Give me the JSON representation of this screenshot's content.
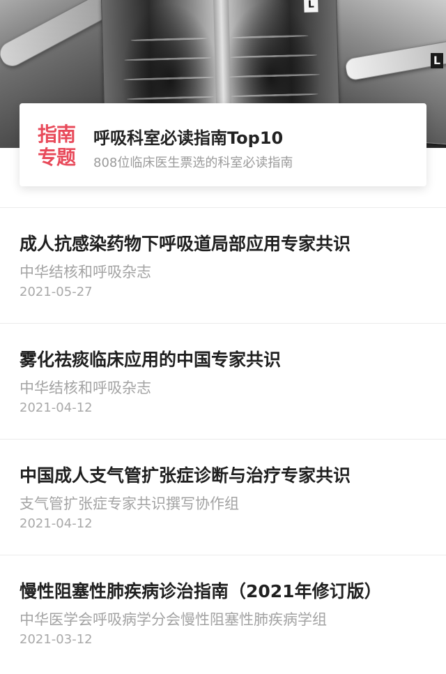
{
  "banner": {
    "image": "chest-xray-collage",
    "film_marker_left": "L",
    "film_marker_right": "L"
  },
  "topic": {
    "tag_line1": "指南",
    "tag_line2": "专题",
    "title": "呼吸科室必读指南Top10",
    "subtitle": "808位临床医生票选的科室必读指南",
    "tag_color": "#e84a5a"
  },
  "guides": [
    {
      "title": "成人抗感染药物下呼吸道局部应用专家共识",
      "source": "中华结核和呼吸杂志",
      "date": "2021-05-27"
    },
    {
      "title": "雾化祛痰临床应用的中国专家共识",
      "source": "中华结核和呼吸杂志",
      "date": "2021-04-12"
    },
    {
      "title": "中国成人支气管扩张症诊断与治疗专家共识",
      "source": "支气管扩张症专家共识撰写协作组",
      "date": "2021-04-12"
    },
    {
      "title": "慢性阻塞性肺疾病诊治指南（2021年修订版）",
      "source": "中华医学会呼吸病学分会慢性阻塞性肺疾病学组",
      "date": "2021-03-12"
    }
  ]
}
